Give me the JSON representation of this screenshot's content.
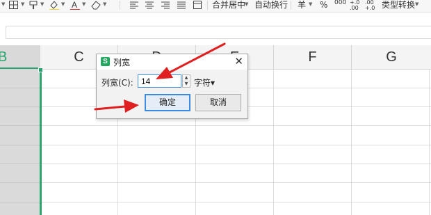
{
  "toolbar": {
    "merge_center_label": "合并居中",
    "wrap_text_label": "自动换行",
    "currency_label": "羊",
    "percent_label": "%",
    "thousands_label": "000",
    "increase_decimal_label": "+.0\n.00",
    "decrease_decimal_label": ".00\n+.0",
    "type_convert_label": "类型转换",
    "font_color": "#d42b2b",
    "highlight_color": "#f3d221"
  },
  "columns": [
    "B",
    "C",
    "D",
    "E",
    "F",
    "G"
  ],
  "selected_column": "B",
  "dialog": {
    "logo_text": "S",
    "title": "列宽",
    "close_glyph": "✕",
    "field_label": "列宽(C):",
    "field_value": "14",
    "unit_label": "字符▾",
    "ok_label": "确定",
    "cancel_label": "取消"
  },
  "colors": {
    "accent_green": "#2aa56f",
    "annotation_red": "#e02020",
    "focus_blue": "#3c8be0"
  },
  "icons": [
    "borders-icon",
    "format-painter-icon",
    "fill-color-icon",
    "font-color-icon",
    "eraser-icon",
    "align-left-icon",
    "align-center-icon",
    "align-right-icon",
    "justify-icon",
    "merge-cells-icon",
    "close-icon",
    "spin-up-icon",
    "spin-down-icon",
    "red-arrow-icon"
  ]
}
